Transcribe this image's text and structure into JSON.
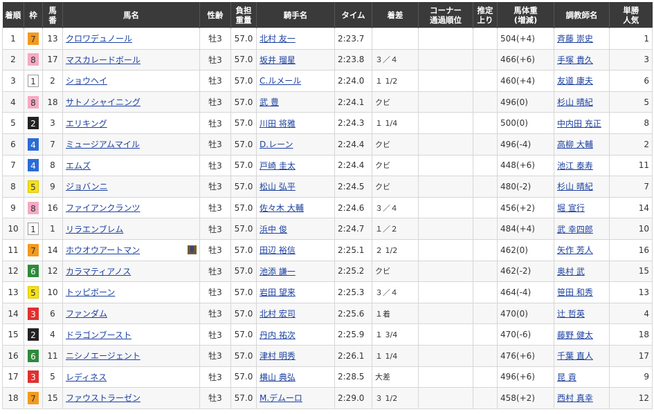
{
  "headers": [
    "着順",
    "枠",
    "馬\n番",
    "馬名",
    "性齢",
    "負担\n重量",
    "騎手名",
    "タイム",
    "着差",
    "コーナー\n通過順位",
    "推定\n上り",
    "馬体重\n(増減)",
    "調教師名",
    "単勝\n人気"
  ],
  "waku_colors": {
    "1": {
      "bg": "#ffffff",
      "fg": "#333333",
      "border": "#999999"
    },
    "2": {
      "bg": "#222222",
      "fg": "#ffffff",
      "border": "#222222"
    },
    "3": {
      "bg": "#e03030",
      "fg": "#ffffff",
      "border": "#e03030"
    },
    "4": {
      "bg": "#2a6bd6",
      "fg": "#ffffff",
      "border": "#2a6bd6"
    },
    "5": {
      "bg": "#f5e11a",
      "fg": "#333333",
      "border": "#d8c400"
    },
    "6": {
      "bg": "#2e8a3c",
      "fg": "#ffffff",
      "border": "#2e8a3c"
    },
    "7": {
      "bg": "#f39a1e",
      "fg": "#333333",
      "border": "#f39a1e"
    },
    "8": {
      "bg": "#f6a9c4",
      "fg": "#333333",
      "border": "#f6a9c4"
    }
  },
  "blinker_label": "B",
  "rows": [
    {
      "pos": "1",
      "waku": "7",
      "num": "13",
      "horse": "クロワデュノール",
      "sex_age": "牡3",
      "weight": "57.0",
      "jockey": "北村 友一",
      "time": "2:23.7",
      "margin": "",
      "corner": "",
      "last3f": "",
      "body": "504",
      "diff": "(+4)",
      "trainer": "斉藤 崇史",
      "pop": "1",
      "blinker": false
    },
    {
      "pos": "2",
      "waku": "8",
      "num": "17",
      "horse": "マスカレードボール",
      "sex_age": "牡3",
      "weight": "57.0",
      "jockey": "坂井 瑠星",
      "time": "2:23.8",
      "margin": "３／４",
      "corner": "",
      "last3f": "",
      "body": "466",
      "diff": "(+6)",
      "trainer": "手塚 貴久",
      "pop": "3",
      "blinker": false
    },
    {
      "pos": "3",
      "waku": "1",
      "num": "2",
      "horse": "ショウヘイ",
      "sex_age": "牡3",
      "weight": "57.0",
      "jockey": "C.ルメール",
      "time": "2:24.0",
      "margin": "１ 1/2",
      "corner": "",
      "last3f": "",
      "body": "460",
      "diff": "(+4)",
      "trainer": "友道 康夫",
      "pop": "6",
      "blinker": false
    },
    {
      "pos": "4",
      "waku": "8",
      "num": "18",
      "horse": "サトノシャイニング",
      "sex_age": "牡3",
      "weight": "57.0",
      "jockey": "武 豊",
      "time": "2:24.1",
      "margin": "クビ",
      "corner": "",
      "last3f": "",
      "body": "496",
      "diff": "(0)",
      "trainer": "杉山 晴紀",
      "pop": "5",
      "blinker": false
    },
    {
      "pos": "5",
      "waku": "2",
      "num": "3",
      "horse": "エリキング",
      "sex_age": "牡3",
      "weight": "57.0",
      "jockey": "川田 将雅",
      "time": "2:24.3",
      "margin": "１ 1/4",
      "corner": "",
      "last3f": "",
      "body": "500",
      "diff": "(0)",
      "trainer": "中内田 充正",
      "pop": "8",
      "blinker": false
    },
    {
      "pos": "6",
      "waku": "4",
      "num": "7",
      "horse": "ミュージアムマイル",
      "sex_age": "牡3",
      "weight": "57.0",
      "jockey": "D.レーン",
      "time": "2:24.4",
      "margin": "クビ",
      "corner": "",
      "last3f": "",
      "body": "496",
      "diff": "(-4)",
      "trainer": "高柳 大輔",
      "pop": "2",
      "blinker": false
    },
    {
      "pos": "7",
      "waku": "4",
      "num": "8",
      "horse": "エムズ",
      "sex_age": "牡3",
      "weight": "57.0",
      "jockey": "戸崎 圭太",
      "time": "2:24.4",
      "margin": "クビ",
      "corner": "",
      "last3f": "",
      "body": "448",
      "diff": "(+6)",
      "trainer": "池江 泰寿",
      "pop": "11",
      "blinker": false
    },
    {
      "pos": "8",
      "waku": "5",
      "num": "9",
      "horse": "ジョバンニ",
      "sex_age": "牡3",
      "weight": "57.0",
      "jockey": "松山 弘平",
      "time": "2:24.5",
      "margin": "クビ",
      "corner": "",
      "last3f": "",
      "body": "480",
      "diff": "(-2)",
      "trainer": "杉山 晴紀",
      "pop": "7",
      "blinker": false
    },
    {
      "pos": "9",
      "waku": "8",
      "num": "16",
      "horse": "ファイアンクランツ",
      "sex_age": "牡3",
      "weight": "57.0",
      "jockey": "佐々木 大輔",
      "time": "2:24.6",
      "margin": "３／４",
      "corner": "",
      "last3f": "",
      "body": "456",
      "diff": "(+2)",
      "trainer": "堀 宣行",
      "pop": "14",
      "blinker": false
    },
    {
      "pos": "10",
      "waku": "1",
      "num": "1",
      "horse": "リラエンブレム",
      "sex_age": "牡3",
      "weight": "57.0",
      "jockey": "浜中 俊",
      "time": "2:24.7",
      "margin": "１／２",
      "corner": "",
      "last3f": "",
      "body": "484",
      "diff": "(+4)",
      "trainer": "武 幸四郎",
      "pop": "10",
      "blinker": false
    },
    {
      "pos": "11",
      "waku": "7",
      "num": "14",
      "horse": "ホウオウアートマン",
      "sex_age": "牡3",
      "weight": "57.0",
      "jockey": "田辺 裕信",
      "time": "2:25.1",
      "margin": "２ 1/2",
      "corner": "",
      "last3f": "",
      "body": "462",
      "diff": "(0)",
      "trainer": "矢作 芳人",
      "pop": "16",
      "blinker": true
    },
    {
      "pos": "12",
      "waku": "6",
      "num": "12",
      "horse": "カラマティアノス",
      "sex_age": "牡3",
      "weight": "57.0",
      "jockey": "池添 謙一",
      "time": "2:25.2",
      "margin": "クビ",
      "corner": "",
      "last3f": "",
      "body": "462",
      "diff": "(-2)",
      "trainer": "奥村 武",
      "pop": "15",
      "blinker": false
    },
    {
      "pos": "13",
      "waku": "5",
      "num": "10",
      "horse": "トッピボーン",
      "sex_age": "牡3",
      "weight": "57.0",
      "jockey": "岩田 望来",
      "time": "2:25.3",
      "margin": "３／４",
      "corner": "",
      "last3f": "",
      "body": "464",
      "diff": "(-4)",
      "trainer": "笹田 和秀",
      "pop": "13",
      "blinker": false
    },
    {
      "pos": "14",
      "waku": "3",
      "num": "6",
      "horse": "ファンダム",
      "sex_age": "牡3",
      "weight": "57.0",
      "jockey": "北村 宏司",
      "time": "2:25.6",
      "margin": "１着",
      "corner": "",
      "last3f": "",
      "body": "470",
      "diff": "(0)",
      "trainer": "辻 哲英",
      "pop": "4",
      "blinker": false
    },
    {
      "pos": "15",
      "waku": "2",
      "num": "4",
      "horse": "ドラゴンブースト",
      "sex_age": "牡3",
      "weight": "57.0",
      "jockey": "丹内 祐次",
      "time": "2:25.9",
      "margin": "１ 3/4",
      "corner": "",
      "last3f": "",
      "body": "470",
      "diff": "(-6)",
      "trainer": "藤野 健太",
      "pop": "18",
      "blinker": false
    },
    {
      "pos": "16",
      "waku": "6",
      "num": "11",
      "horse": "ニシノエージェント",
      "sex_age": "牡3",
      "weight": "57.0",
      "jockey": "津村 明秀",
      "time": "2:26.1",
      "margin": "１ 1/4",
      "corner": "",
      "last3f": "",
      "body": "476",
      "diff": "(+6)",
      "trainer": "千葉 直人",
      "pop": "17",
      "blinker": false
    },
    {
      "pos": "17",
      "waku": "3",
      "num": "5",
      "horse": "レディネス",
      "sex_age": "牡3",
      "weight": "57.0",
      "jockey": "横山 典弘",
      "time": "2:28.5",
      "margin": "大差",
      "corner": "",
      "last3f": "",
      "body": "496",
      "diff": "(+6)",
      "trainer": "昆 貢",
      "pop": "9",
      "blinker": false
    },
    {
      "pos": "18",
      "waku": "7",
      "num": "15",
      "horse": "ファウストラーゼン",
      "sex_age": "牡3",
      "weight": "57.0",
      "jockey": "M.デムーロ",
      "time": "2:29.0",
      "margin": "３ 1/2",
      "corner": "",
      "last3f": "",
      "body": "458",
      "diff": "(+2)",
      "trainer": "西村 真幸",
      "pop": "12",
      "blinker": false
    }
  ]
}
